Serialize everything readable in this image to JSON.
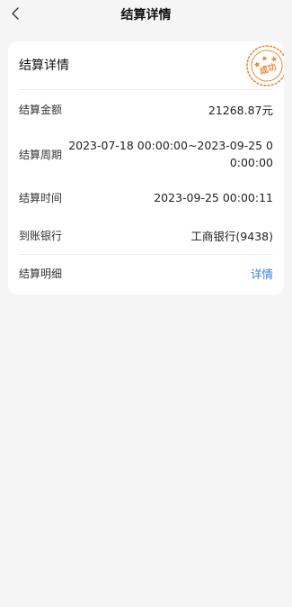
{
  "nav": {
    "title": "结算详情",
    "back_icon": "chevron-left-icon"
  },
  "card": {
    "title": "结算详情",
    "stamp": {
      "text": "成功",
      "color": "#e8893a",
      "icon": "success-stamp-icon"
    },
    "rows": [
      {
        "label": "结算金额",
        "value": "21268.87元"
      },
      {
        "label": "结算周期",
        "value": "2023-07-18 00:00:00~2023-09-25 00:00:00"
      },
      {
        "label": "结算时间",
        "value": "2023-09-25 00:00:11"
      },
      {
        "label": "到账银行",
        "value": "工商银行(9438)"
      },
      {
        "label": "结算明细",
        "value": "详情",
        "link_color": "#3a7de3"
      }
    ]
  }
}
